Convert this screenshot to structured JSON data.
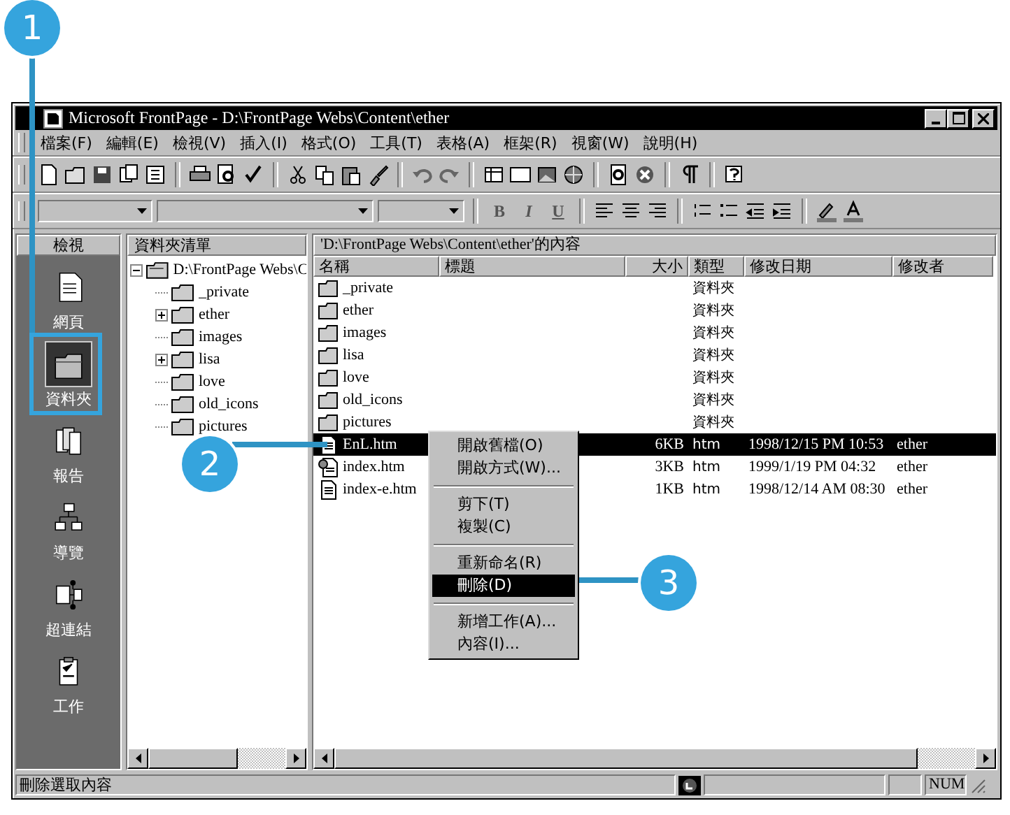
{
  "window": {
    "title": "Microsoft FrontPage - D:\\FrontPage Webs\\Content\\ether"
  },
  "menu": [
    "檔案(F)",
    "編輯(E)",
    "檢視(V)",
    "插入(I)",
    "格式(O)",
    "工具(T)",
    "表格(A)",
    "框架(R)",
    "視窗(W)",
    "說明(H)"
  ],
  "format_toolbar": {
    "bold": "B",
    "italic": "I",
    "underline": "U"
  },
  "views_bar": {
    "title": "檢視",
    "items": [
      {
        "label": "網頁",
        "kind": "page",
        "selected": false
      },
      {
        "label": "資料夾",
        "kind": "folder",
        "selected": true
      },
      {
        "label": "報告",
        "kind": "report",
        "selected": false
      },
      {
        "label": "導覽",
        "kind": "navigation",
        "selected": false
      },
      {
        "label": "超連結",
        "kind": "hyperlink",
        "selected": false
      },
      {
        "label": "工作",
        "kind": "task",
        "selected": false
      }
    ]
  },
  "folder_list": {
    "title": "資料夾清單",
    "root": {
      "label": "D:\\FrontPage Webs\\C",
      "expanded": true,
      "children": [
        {
          "label": "_private",
          "expandable": false
        },
        {
          "label": "ether",
          "expandable": true
        },
        {
          "label": "images",
          "expandable": false
        },
        {
          "label": "lisa",
          "expandable": true
        },
        {
          "label": "love",
          "expandable": false
        },
        {
          "label": "old_icons",
          "expandable": false
        },
        {
          "label": "pictures",
          "expandable": false
        }
      ]
    }
  },
  "contents": {
    "title": "'D:\\FrontPage Webs\\Content\\ether'的內容",
    "columns": [
      "名稱",
      "標題",
      "大小",
      "類型",
      "修改日期",
      "修改者"
    ],
    "rows": [
      {
        "kind": "folder",
        "name": "_private",
        "type": "資料夾",
        "selected": false
      },
      {
        "kind": "folder",
        "name": "ether",
        "type": "資料夾",
        "selected": false
      },
      {
        "kind": "folder",
        "name": "images",
        "type": "資料夾",
        "selected": false
      },
      {
        "kind": "folder",
        "name": "lisa",
        "type": "資料夾",
        "selected": false
      },
      {
        "kind": "folder",
        "name": "love",
        "type": "資料夾",
        "selected": false
      },
      {
        "kind": "folder",
        "name": "old_icons",
        "type": "資料夾",
        "selected": false
      },
      {
        "kind": "folder",
        "name": "pictures",
        "type": "資料夾",
        "selected": false
      },
      {
        "kind": "file",
        "name": "EnL.htm",
        "size": "6KB",
        "type": "htm",
        "modified": "1998/12/15 PM 10:53",
        "modified_by": "ether",
        "selected": true
      },
      {
        "kind": "home",
        "name": "index.htm",
        "size": "3KB",
        "type": "htm",
        "modified": "1999/1/19 PM 04:32",
        "modified_by": "ether",
        "selected": false
      },
      {
        "kind": "file",
        "name": "index-e.htm",
        "size": "1KB",
        "type": "htm",
        "modified": "1998/12/14 AM 08:30",
        "modified_by": "ether",
        "selected": false
      }
    ]
  },
  "context_menu": [
    {
      "kind": "item",
      "label": "開啟舊檔(O)",
      "selected": false
    },
    {
      "kind": "item",
      "label": "開啟方式(W)...",
      "selected": false
    },
    {
      "kind": "separator"
    },
    {
      "kind": "item",
      "label": "剪下(T)",
      "selected": false
    },
    {
      "kind": "item",
      "label": "複製(C)",
      "selected": false
    },
    {
      "kind": "separator"
    },
    {
      "kind": "item",
      "label": "重新命名(R)",
      "selected": false
    },
    {
      "kind": "item",
      "label": "刪除(D)",
      "selected": true
    },
    {
      "kind": "separator"
    },
    {
      "kind": "item",
      "label": "新增工作(A)...",
      "selected": false
    },
    {
      "kind": "item",
      "label": "內容(I)...",
      "selected": false
    }
  ],
  "status_bar": {
    "message": "刪除選取內容",
    "indicator": "NUM"
  },
  "callouts": [
    "1",
    "2",
    "3"
  ]
}
